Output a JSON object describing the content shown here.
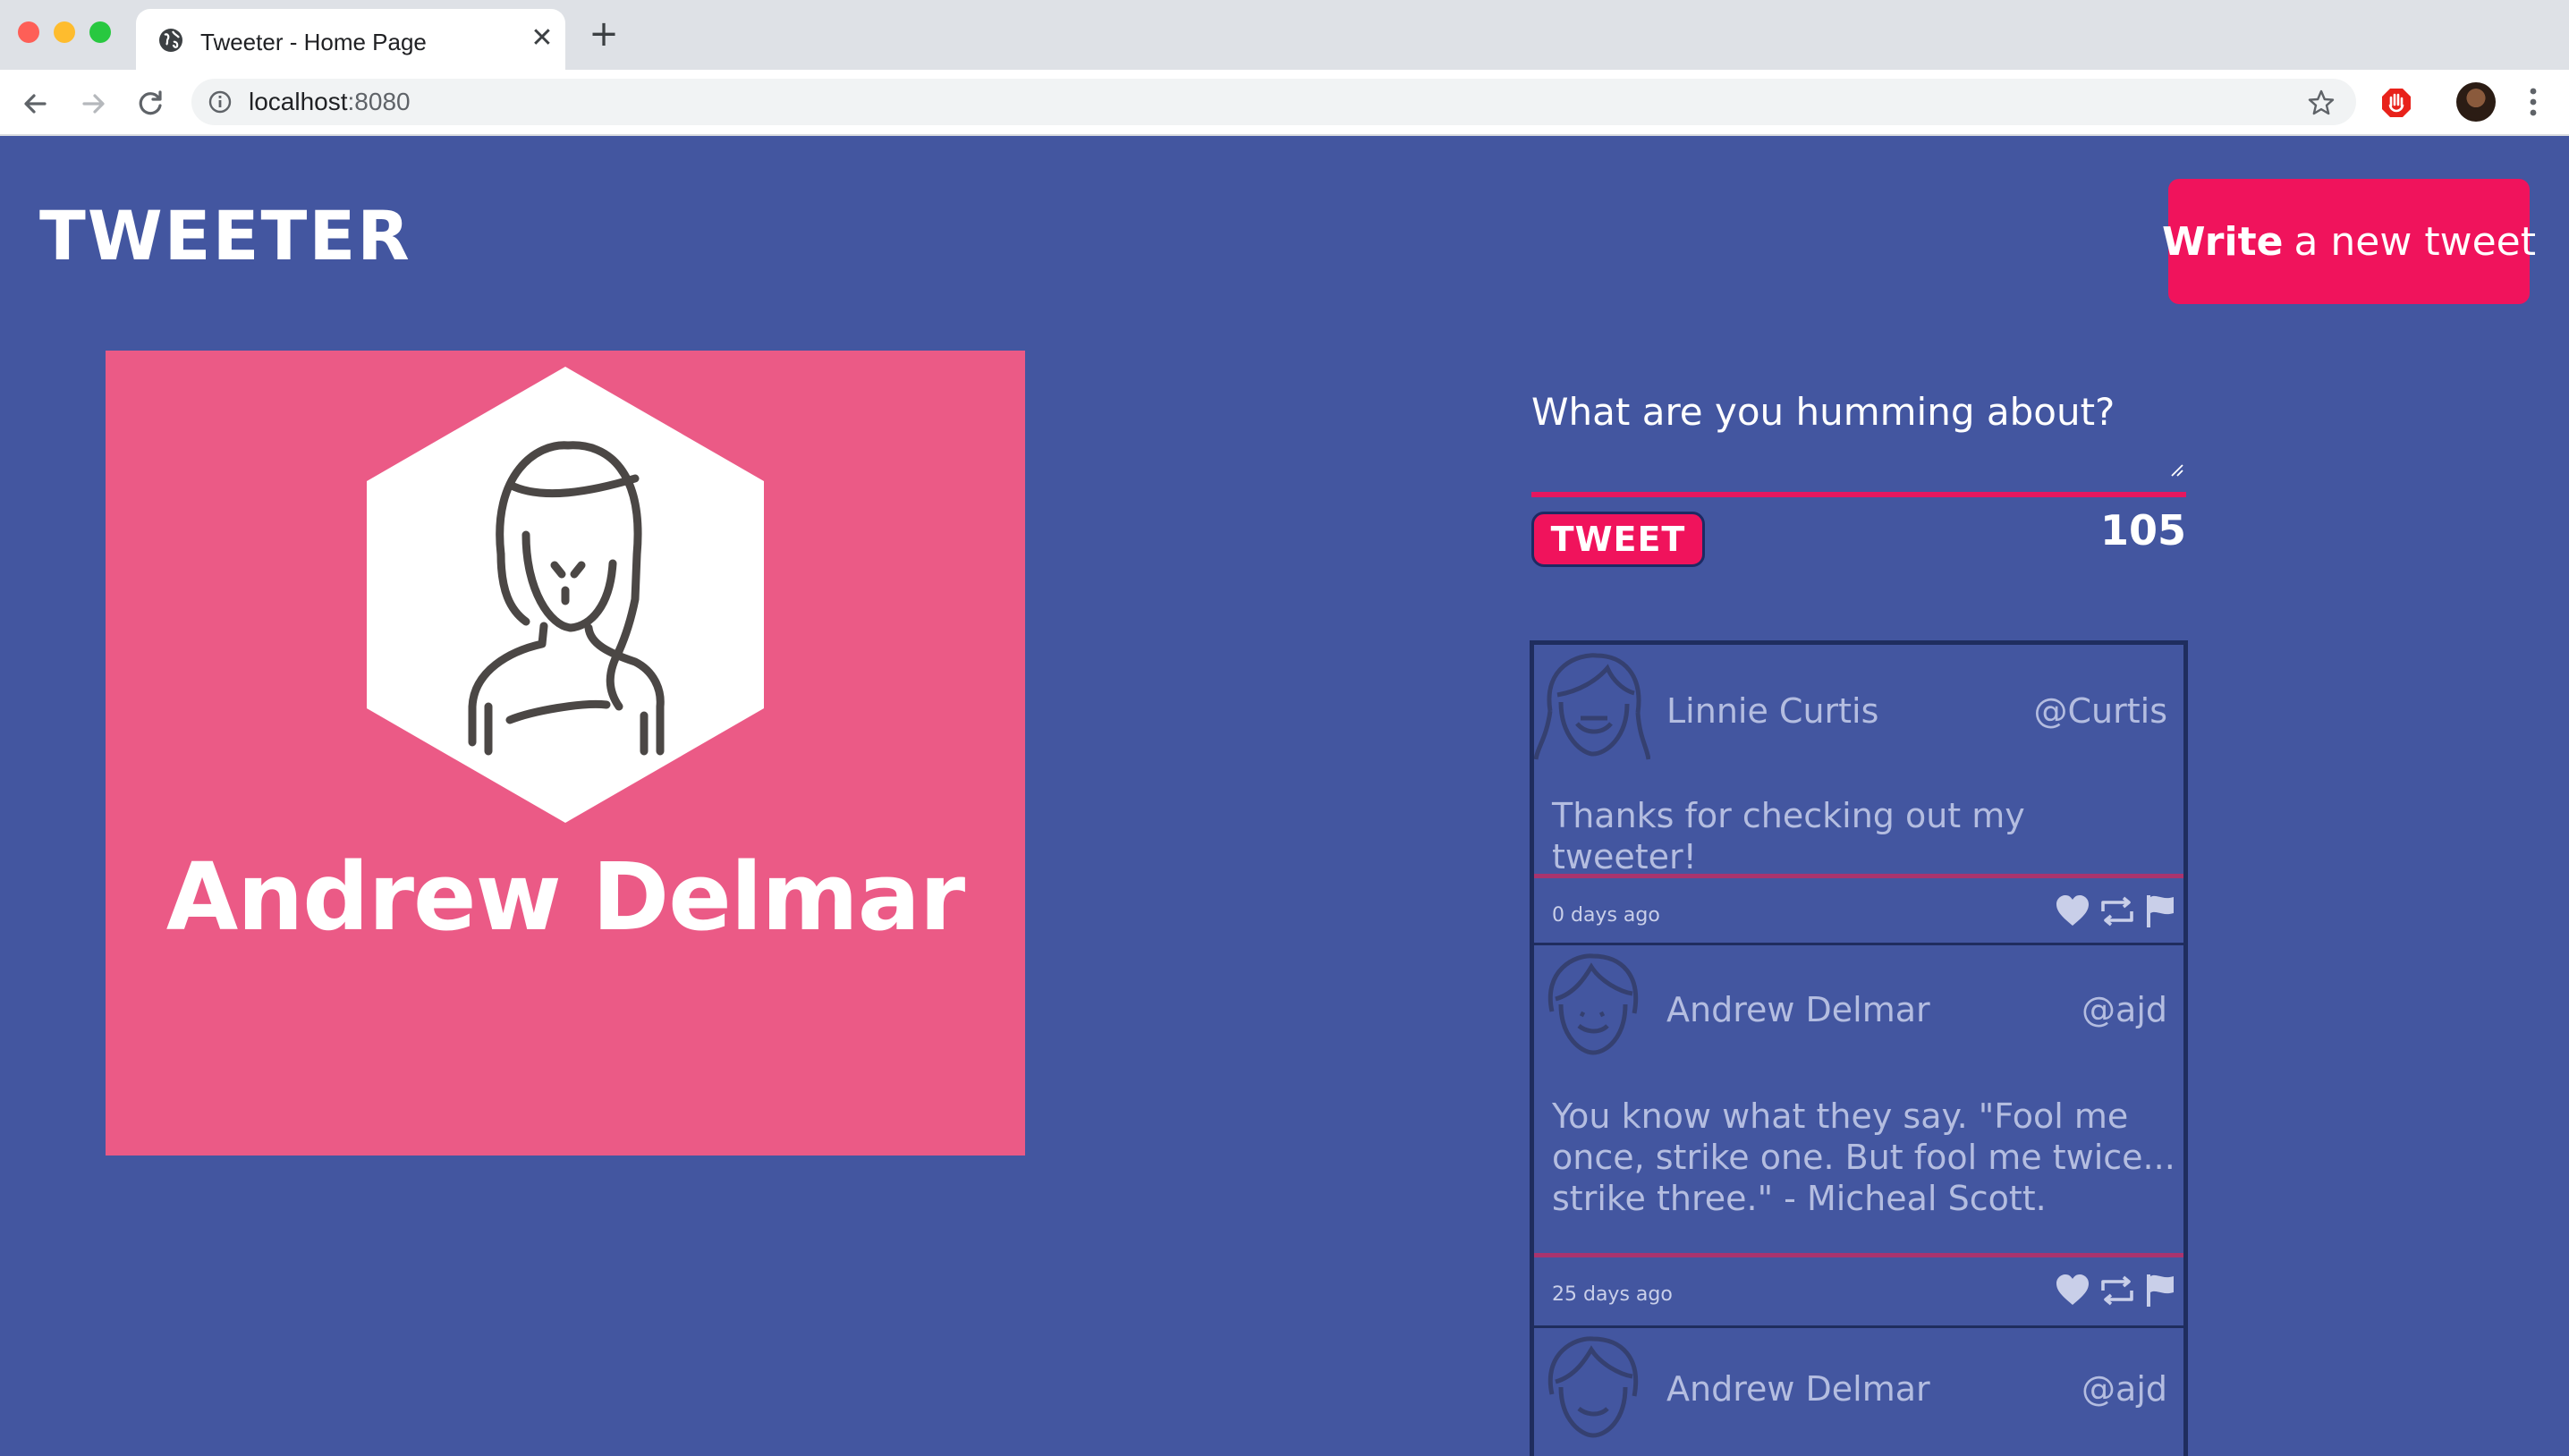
{
  "browser": {
    "tab_title": "Tweeter - Home Page",
    "tab_close": "✕",
    "new_tab": "+",
    "url_host": "localhost",
    "url_port": ":8080"
  },
  "header": {
    "brand": "TWEETER",
    "write_strong": "Write",
    "write_rest": "a new tweet"
  },
  "profile": {
    "name": "Andrew Delmar",
    "card_color": "#eb5a86"
  },
  "compose": {
    "placeholder": "What are you humming about?",
    "button_label": "TWEET",
    "counter": "105"
  },
  "tweets": [
    {
      "name": "Linnie Curtis",
      "handle": "@Curtis",
      "text": "Thanks for checking out my tweeter!",
      "time": "0 days ago"
    },
    {
      "name": "Andrew Delmar",
      "handle": "@ajd",
      "text": "You know what they say. \"Fool me once, strike one. But fool me twice... strike three.\" - Micheal Scott.",
      "time": "25 days ago"
    },
    {
      "name": "Andrew Delmar",
      "handle": "@ajd"
    }
  ],
  "icons": {
    "like": "heart-icon",
    "retweet": "retweet-icon",
    "flag": "flag-icon"
  },
  "colors": {
    "background": "#4356a0",
    "accent": "#f0135c",
    "tweet_text": "#b4bde0"
  }
}
